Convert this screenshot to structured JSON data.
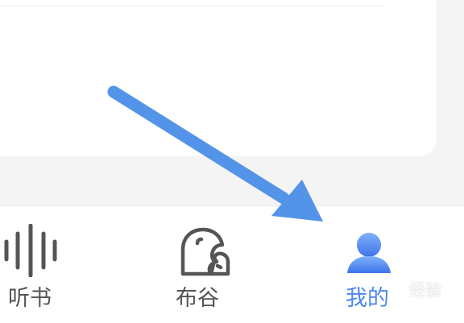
{
  "colors": {
    "page_background": "#f4f4f4",
    "card_background": "#ffffff",
    "tab_inactive": "#555555",
    "tab_active": "#4f86ee",
    "annotation_arrow": "#5393e8"
  },
  "tab_bar": {
    "active_tab": "mine",
    "tabs": [
      {
        "id": "listen",
        "label": "听书",
        "icon": "audio-wave-icon",
        "active": false
      },
      {
        "id": "bugu",
        "label": "布谷",
        "icon": "bird-icon",
        "active": false
      },
      {
        "id": "mine",
        "label": "我的",
        "icon": "user-icon",
        "active": true
      }
    ]
  },
  "annotation": {
    "type": "arrow",
    "points_to": "mine"
  },
  "watermark": {
    "text": "经验"
  }
}
